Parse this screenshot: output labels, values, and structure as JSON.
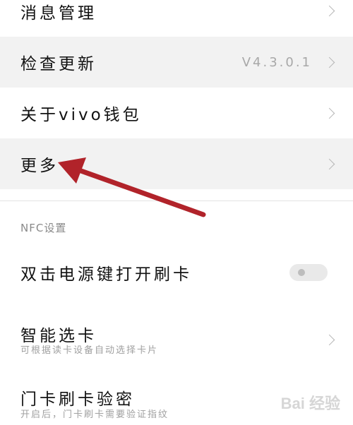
{
  "menu": {
    "message_manage": "消息管理",
    "check_update": "检查更新",
    "check_update_version": "V4.3.0.1",
    "about": "关于vivo钱包",
    "more": "更多"
  },
  "nfc": {
    "section_title": "NFC设置",
    "double_click_power": "双击电源键打开刷卡",
    "smart_select": "智能选卡",
    "smart_select_desc": "可根据读卡设备自动选择卡片",
    "door_card_verify": "门卡刷卡验密",
    "door_card_verify_desc": "开启后，门卡刷卡需要验证指纹"
  },
  "watermark": "Bai 经验",
  "colors": {
    "arrow": "#b1232a",
    "highlight_row": "#f2f2f2"
  }
}
